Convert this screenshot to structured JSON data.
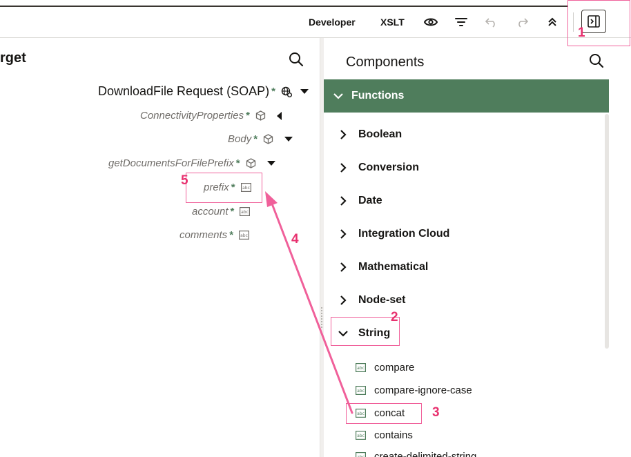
{
  "toolbar": {
    "developer_label": "Developer",
    "xslt_label": "XSLT",
    "icons": [
      "eye-icon",
      "filter-icon",
      "undo-icon",
      "redo-icon",
      "collapse-up-icon",
      "panel-toggle-icon"
    ]
  },
  "target": {
    "title": "rget",
    "nodes": [
      {
        "label": "DownloadFile Request (SOAP)",
        "required": "*",
        "icon": "globe-gear-icon",
        "caret": "down"
      },
      {
        "label": "ConnectivityProperties",
        "required": "*",
        "icon": "cube-icon",
        "caret": "left"
      },
      {
        "label": "Body",
        "required": "*",
        "icon": "cube-icon",
        "caret": "down"
      },
      {
        "label": "getDocumentsForFilePrefix",
        "required": "*",
        "icon": "cube-icon",
        "caret": "down"
      },
      {
        "label": "prefix",
        "required": "*",
        "icon": "abc-icon"
      },
      {
        "label": "account",
        "required": "*",
        "icon": "abc-icon"
      },
      {
        "label": "comments",
        "required": "*",
        "icon": "abc-icon"
      }
    ]
  },
  "components": {
    "title": "Components",
    "functions_label": "Functions",
    "categories": [
      "Boolean",
      "Conversion",
      "Date",
      "Integration Cloud",
      "Mathematical",
      "Node-set",
      "String"
    ],
    "string_functions": [
      "compare",
      "compare-ignore-case",
      "concat",
      "contains",
      "create-delimited-string"
    ]
  },
  "annotations": [
    "1",
    "2",
    "3",
    "4",
    "5"
  ],
  "colors": {
    "functions_bar": "#4f7d5c",
    "required_star": "#4f7d5c",
    "annotation": "#e8316f"
  }
}
